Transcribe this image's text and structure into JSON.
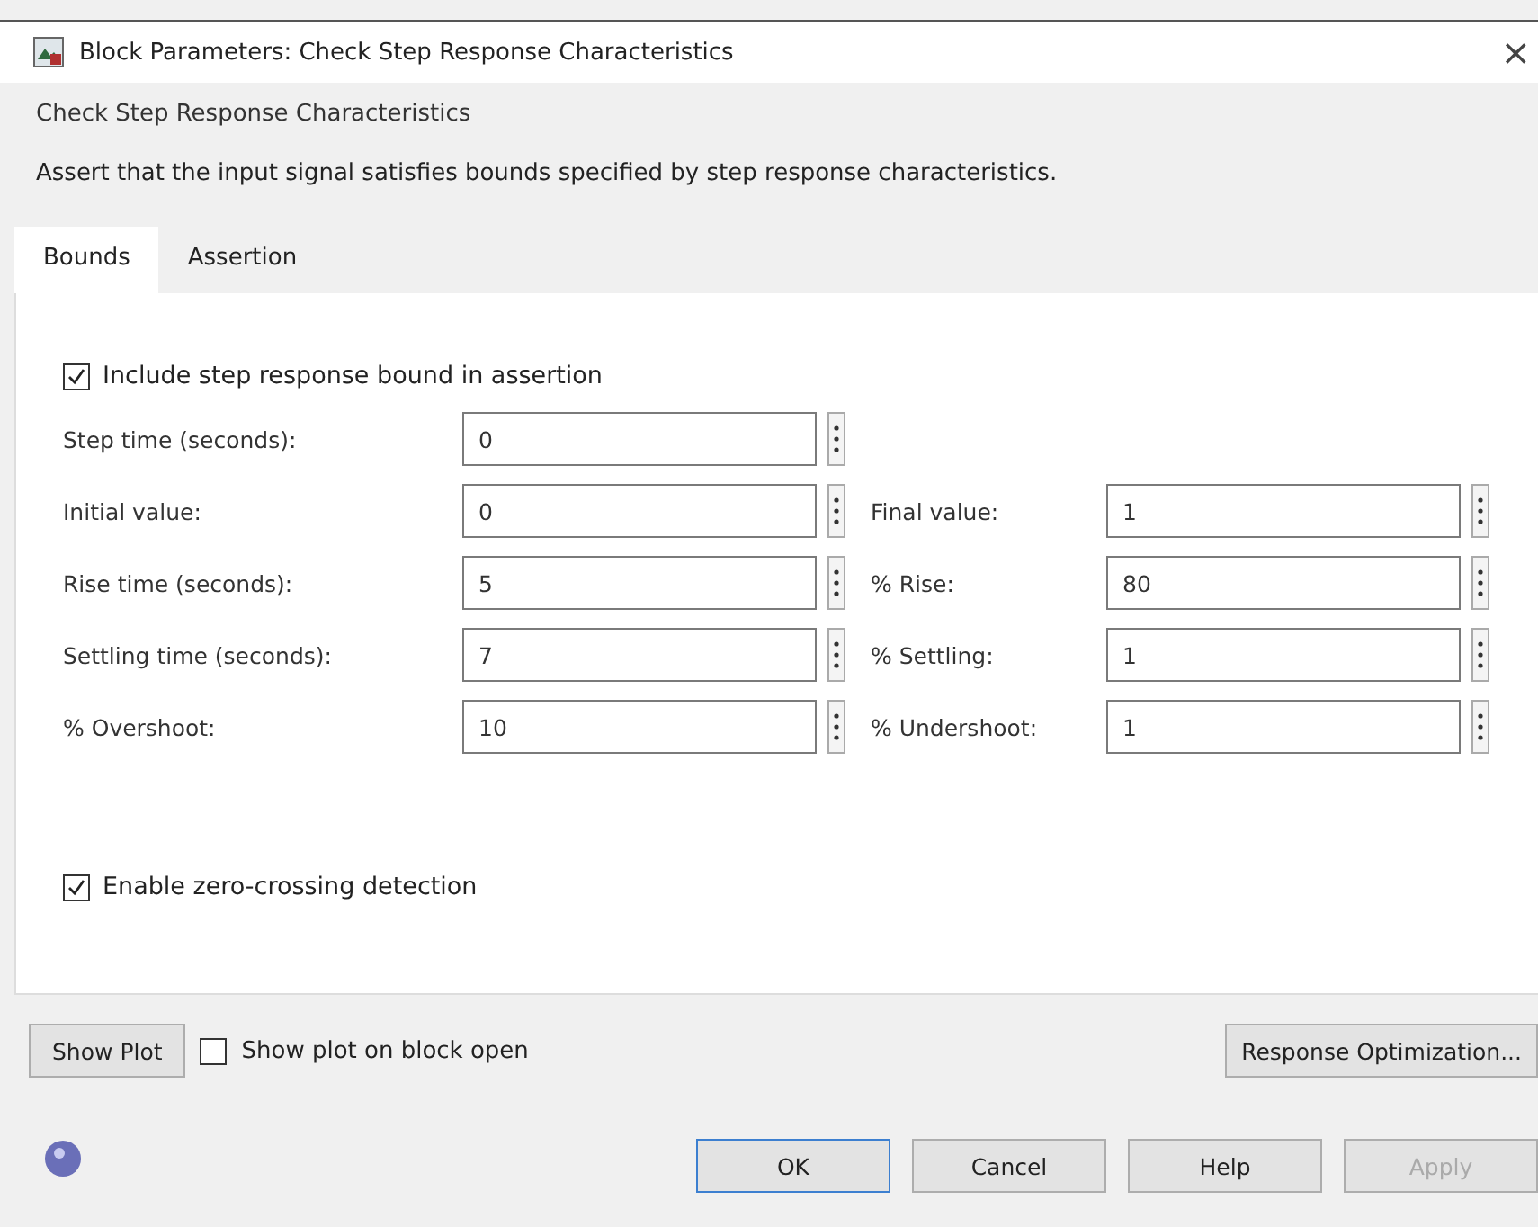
{
  "window": {
    "title": "Block Parameters: Check Step Response Characteristics",
    "close": "×"
  },
  "group_title": "Check Step Response Characteristics",
  "description": "Assert that the input signal satisfies bounds specified by step response characteristics.",
  "tabs": [
    {
      "label": "Bounds",
      "selected": true
    },
    {
      "label": "Assertion",
      "selected": false
    }
  ],
  "include_bound": {
    "label": "Include step response bound in assertion",
    "checked": true
  },
  "rows": [
    {
      "fields": [
        {
          "label": "Step time (seconds):",
          "value": "0"
        }
      ]
    },
    {
      "fields": [
        {
          "label": "Initial value:",
          "value": "0"
        },
        {
          "label": "Final value:",
          "value": "1"
        }
      ]
    },
    {
      "fields": [
        {
          "label": "Rise time (seconds):",
          "value": "5"
        },
        {
          "label": "% Rise:",
          "value": "80"
        }
      ]
    },
    {
      "fields": [
        {
          "label": "Settling time (seconds):",
          "value": "7"
        },
        {
          "label": "% Settling:",
          "value": "1"
        }
      ]
    },
    {
      "fields": [
        {
          "label": "% Overshoot:",
          "value": "10"
        },
        {
          "label": "% Undershoot:",
          "value": "1"
        }
      ]
    }
  ],
  "zero_crossing": {
    "label": "Enable zero-crossing detection",
    "checked": true
  },
  "show_plot_button": "Show Plot",
  "show_plot_on_open": {
    "label": "Show plot on block open",
    "checked": false
  },
  "response_optimization_button": "Response Optimization...",
  "buttons": [
    {
      "label": "OK",
      "disabled": false,
      "default": true
    },
    {
      "label": "Cancel",
      "disabled": false,
      "default": false
    },
    {
      "label": "Help",
      "disabled": false,
      "default": false
    },
    {
      "label": "Apply",
      "disabled": true,
      "default": false
    }
  ]
}
